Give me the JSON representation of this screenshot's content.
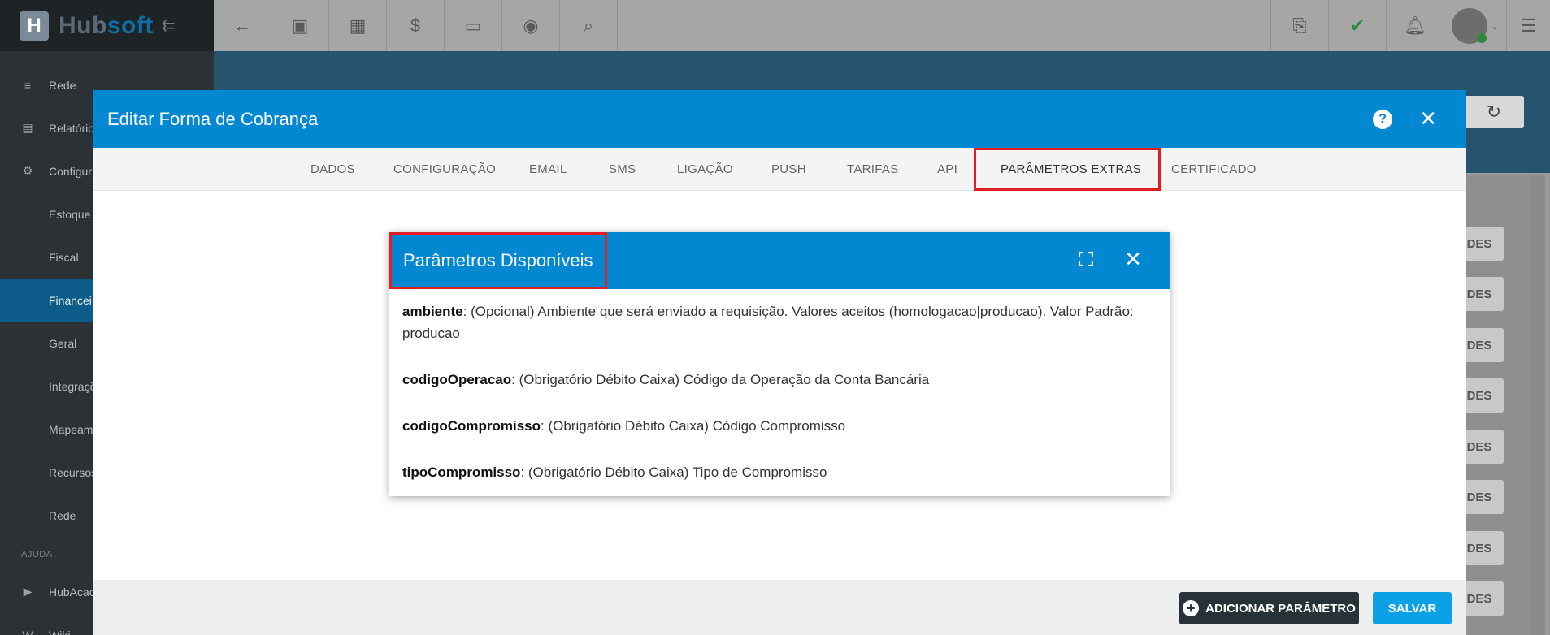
{
  "brand": {
    "name_a": "Hub",
    "name_b": "soft",
    "logo_letter": "H"
  },
  "toolbar": {
    "icons": [
      "back-arrow-icon",
      "contact-card-icon",
      "calendar-clock-icon",
      "dollar-icon",
      "terminal-icon",
      "eye-icon",
      "search-icon"
    ],
    "right_icons": [
      "pdf-icon",
      "check-chat-icon",
      "bell-icon",
      "user-avatar",
      "menu-icon"
    ]
  },
  "sidebar": {
    "items": [
      {
        "label": "Rede",
        "icon": "server-icon"
      },
      {
        "label": "Relatório",
        "icon": "report-icon"
      },
      {
        "label": "Configur",
        "icon": "gear-icon"
      },
      {
        "label": "Estoque"
      },
      {
        "label": "Fiscal"
      },
      {
        "label": "Financei"
      },
      {
        "label": "Geral"
      },
      {
        "label": "Integraçõ"
      },
      {
        "label": "Mapeam"
      },
      {
        "label": "Recursos"
      },
      {
        "label": "Rede"
      }
    ],
    "section_ajuda": "AJUDA",
    "help_items": [
      {
        "label": "HubAcac",
        "icon": "video-icon"
      },
      {
        "label": "Wiki",
        "icon": "wiki-icon"
      }
    ]
  },
  "background": {
    "action_label": "DES"
  },
  "modal": {
    "title": "Editar Forma de Cobrança",
    "tabs": [
      "DADOS",
      "CONFIGURAÇÃO",
      "EMAIL",
      "SMS",
      "LIGAÇÃO",
      "PUSH",
      "TARIFAS",
      "API",
      "PARÂMETROS EXTRAS",
      "CERTIFICADO"
    ],
    "selected_tab": "PARÂMETROS EXTRAS",
    "add_button": "ADICIONAR PARÂMETRO",
    "save_button": "SALVAR"
  },
  "dialog": {
    "title": "Parâmetros Disponíveis",
    "params": [
      {
        "name": "ambiente",
        "desc": ": (Opcional) Ambiente que será enviado a requisição. Valores aceitos (homologacao|producao). Valor Padrão: producao"
      },
      {
        "name": "codigoOperacao",
        "desc": ": (Obrigatório Débito Caixa) Código da Operação da Conta Bancária"
      },
      {
        "name": "codigoCompromisso",
        "desc": ": (Obrigatório Débito Caixa) Código Compromisso"
      },
      {
        "name": "tipoCompromisso",
        "desc": ": (Obrigatório Débito Caixa) Tipo de Compromisso"
      }
    ]
  },
  "colors": {
    "primary": "#0288d1",
    "highlight": "#e21d24",
    "sidebar_active": "#0c5b88",
    "dark_button": "#263238",
    "save_button": "#0ba1e6"
  }
}
